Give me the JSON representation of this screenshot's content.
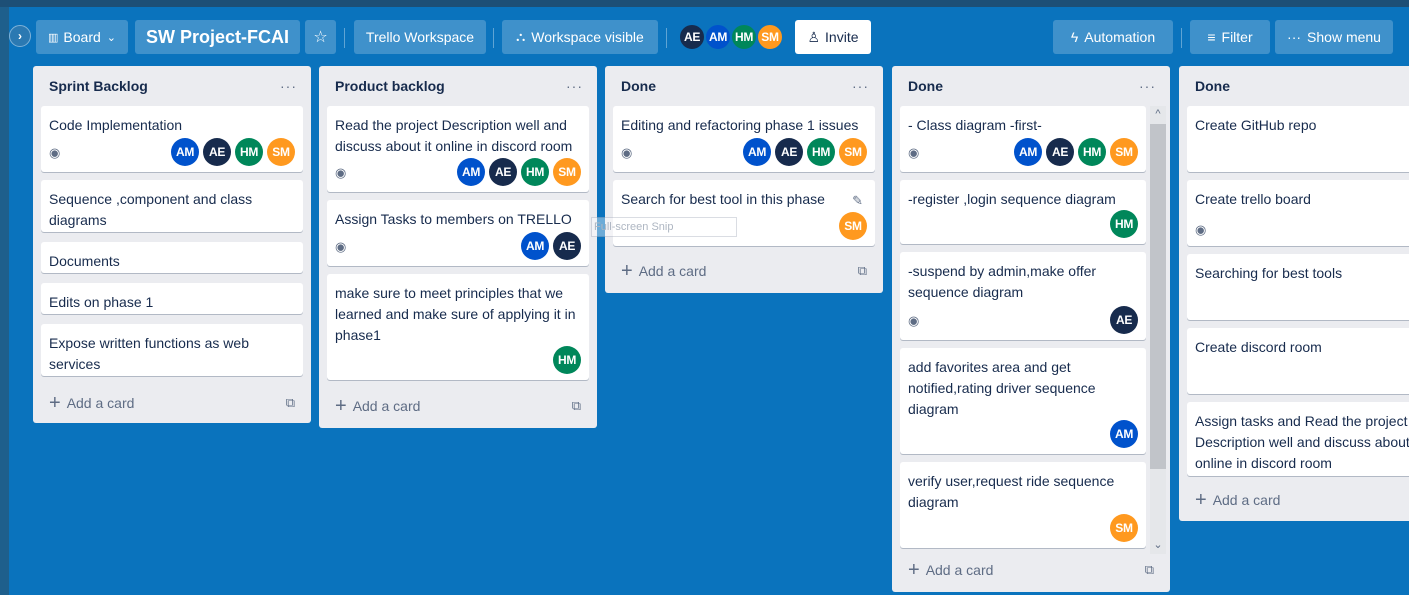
{
  "header": {
    "board_switcher_label": "Board",
    "board_title": "SW Project-FCAI",
    "workspace_label": "Trello Workspace",
    "visibility_label": "Workspace visible",
    "members": [
      "AE",
      "AM",
      "HM",
      "SM"
    ],
    "invite_label": "Invite",
    "automation_label": "Automation",
    "filter_label": "Filter",
    "show_menu_label": "Show menu"
  },
  "lists": [
    {
      "title": "Sprint Backlog",
      "menu": "···",
      "cards": [
        {
          "text": "Code Implementation",
          "watch": true,
          "members": [
            "AM",
            "AE",
            "HM",
            "SM"
          ]
        },
        {
          "text": "Sequence ,component and class diagrams",
          "members": []
        },
        {
          "text": "Documents",
          "members": []
        },
        {
          "text": "Edits on phase 1",
          "members": []
        },
        {
          "text": "Expose written functions as web services",
          "members": []
        }
      ],
      "add_label": "Add a card"
    },
    {
      "title": "Product backlog",
      "menu": "···",
      "cards": [
        {
          "text": "Read the project Description well and discuss about it online in discord room",
          "watch": true,
          "members": [
            "AM",
            "AE",
            "HM",
            "SM"
          ]
        },
        {
          "text": "Assign Tasks to members on TRELLO",
          "watch": true,
          "members": [
            "AM",
            "AE"
          ]
        },
        {
          "text": "make sure to meet principles that we learned and make sure of applying it in phase1",
          "members": [
            "HM"
          ]
        }
      ],
      "add_label": "Add a card"
    },
    {
      "title": "Done",
      "menu": "···",
      "cards": [
        {
          "text": "Editing and refactoring phase 1 issues",
          "watch": true,
          "members": [
            "AM",
            "AE",
            "HM",
            "SM"
          ]
        },
        {
          "text": "Search for best tool in this phase",
          "members": [
            "SM"
          ]
        }
      ],
      "add_label": "Add a card"
    },
    {
      "title": "Done",
      "menu": "···",
      "cards": [
        {
          "text": "- Class diagram -first-",
          "watch": true,
          "members": [
            "AM",
            "AE",
            "HM",
            "SM"
          ]
        },
        {
          "text": "-register ,login sequence diagram",
          "members": [
            "HM"
          ]
        },
        {
          "text": "-suspend by admin,make offer sequence diagram",
          "watch": true,
          "members": [
            "AE"
          ]
        },
        {
          "text": "add favorites area and get notified,rating driver sequence diagram",
          "members": [
            "AM"
          ]
        },
        {
          "text": "verify user,request ride sequence diagram",
          "members": [
            "SM"
          ]
        }
      ],
      "add_label": "Add a card"
    },
    {
      "title": "Done",
      "cards": [
        {
          "text": "Create GitHub repo"
        },
        {
          "text": "Create trello board",
          "watch": true
        },
        {
          "text": "Searching for best tools"
        },
        {
          "text": "Create discord room"
        },
        {
          "text": "Assign tasks and Read the project Description well and discuss about it online in discord room"
        }
      ],
      "add_label": "Add a card"
    }
  ],
  "overlay": {
    "snip_label": "Full-screen Snip"
  }
}
